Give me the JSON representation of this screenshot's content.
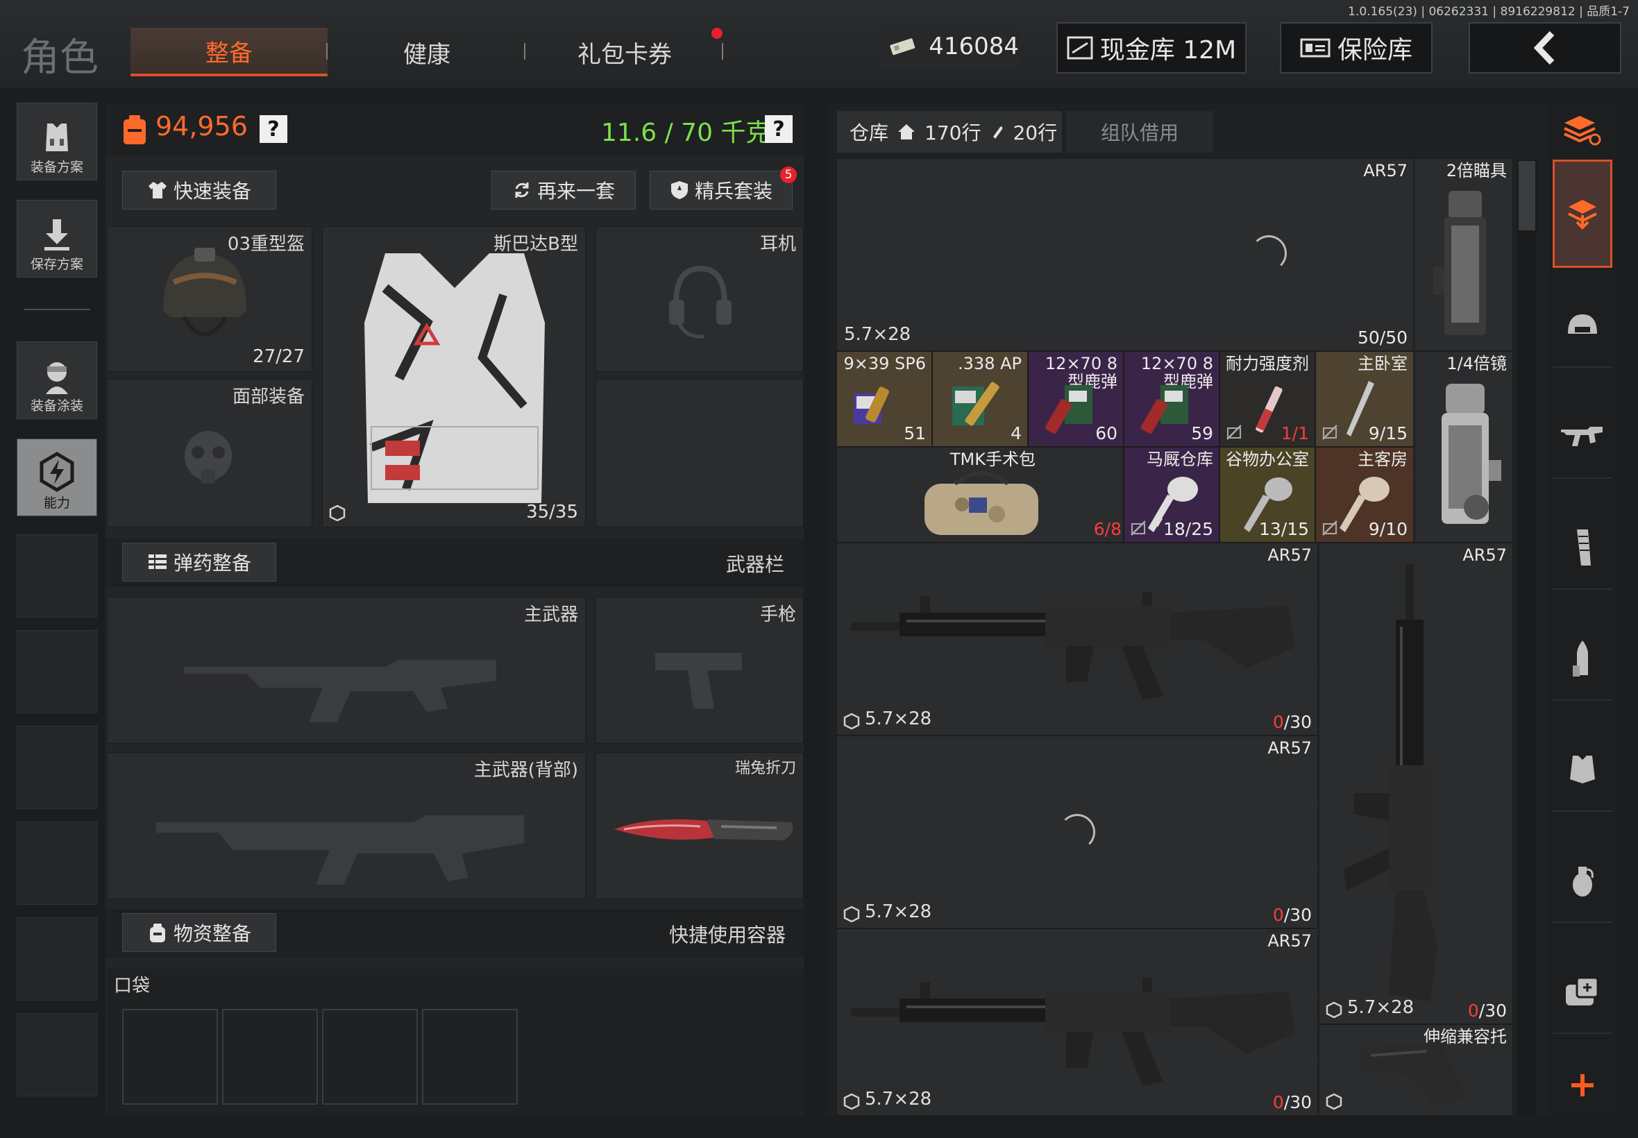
{
  "header": {
    "version": "1.0.165(23) | 06262331 | 8916229812 | 品质1-7",
    "title": "角色",
    "tabs": [
      {
        "label": "整备"
      },
      {
        "label": "健康"
      },
      {
        "label": "礼包卡券"
      }
    ],
    "currency": "416084",
    "cash_vault": "现金库 12M",
    "safe": "保险库"
  },
  "sidebar": {
    "items": [
      {
        "label": "装备方案"
      },
      {
        "label": "保存方案"
      },
      {
        "label": "装备涂装"
      },
      {
        "label": "能力"
      }
    ]
  },
  "stats": {
    "value": "94,956",
    "weight": "11.6 / 70 千克",
    "help": "?"
  },
  "actions": {
    "quick_equip": "快速装备",
    "again": "再来一套",
    "elite": "精兵套装",
    "elite_badge": "5"
  },
  "gear": {
    "helmet": {
      "label": "03重型盔",
      "count": "27/27"
    },
    "armor": {
      "label": "斯巴达B型",
      "count": "35/35"
    },
    "headset": {
      "label": "耳机"
    },
    "face": {
      "label": "面部装备"
    }
  },
  "weapons": {
    "ammo_equip": "弹药整备",
    "weapon_bar": "武器栏",
    "primary": "主武器",
    "pistol": "手枪",
    "primary_back": "主武器(背部)",
    "knife": "瑞兔折刀"
  },
  "supplies": {
    "label": "物资整备",
    "quick_container": "快捷使用容器",
    "pocket": "口袋"
  },
  "warehouse": {
    "tab": "仓库",
    "rows": "170行",
    "rows2": "20行",
    "team": "组队借用",
    "items": [
      {
        "label": "AR57",
        "ammo": "5.7×28",
        "count": "50/50"
      },
      {
        "label": "2倍瞄具"
      },
      {
        "label": "9×39 SP6",
        "count": "51"
      },
      {
        "label": ".338 AP",
        "count": "4"
      },
      {
        "label": "12×70 8型鹿弹",
        "count": "60"
      },
      {
        "label": "12×70 8型鹿弹",
        "count": "59"
      },
      {
        "label": "耐力强度剂",
        "count": "1/1"
      },
      {
        "label": "主卧室",
        "count": "9/15"
      },
      {
        "label": "1/4倍镜"
      },
      {
        "label": "TMK手术包",
        "count": "6/8"
      },
      {
        "label": "马厩仓库",
        "count": "18/25"
      },
      {
        "label": "谷物办公室",
        "count": "13/15"
      },
      {
        "label": "主客房",
        "count": "9/10"
      },
      {
        "label": "AR57",
        "ammo": "5.7×28",
        "count_red": "0",
        "count_rest": "/30"
      },
      {
        "label": "AR57",
        "ammo": "5.7×28",
        "count_red": "0",
        "count_rest": "/30"
      },
      {
        "label": "AR57",
        "ammo": "5.7×28",
        "count_red": "0",
        "count_rest": "/30"
      },
      {
        "label": "AR57",
        "ammo": "5.7×28",
        "count_red": "0",
        "count_rest": "/30"
      },
      {
        "label": "伸缩兼容托"
      }
    ]
  },
  "colors": {
    "accent": "#ff6a2b",
    "green": "#7ee04a",
    "red": "#ff3b3b"
  }
}
